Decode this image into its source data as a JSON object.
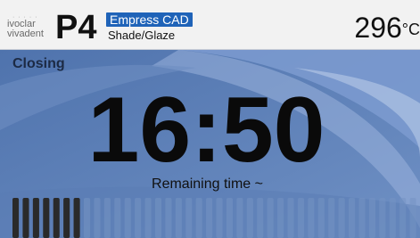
{
  "header": {
    "logo_line1": "ivoclar",
    "logo_line2": "vivadent",
    "model": "P4",
    "program": "Empress CAD",
    "program_sub": "Shade/Glaze",
    "temperature": "296",
    "temperature_unit": "°C"
  },
  "main": {
    "status": "Closing",
    "time": "16:50",
    "time_label": "Remaining time ~"
  },
  "progress": {
    "fraction": 0.16,
    "segments": 40,
    "filled_segments": 7
  },
  "colors": {
    "header_bg": "#f2f2f2",
    "panel_bg": "#5f82b8",
    "badge": "#1f63b8",
    "segment_filled": "#2a2a2a",
    "segment_empty": "#7593c2"
  }
}
